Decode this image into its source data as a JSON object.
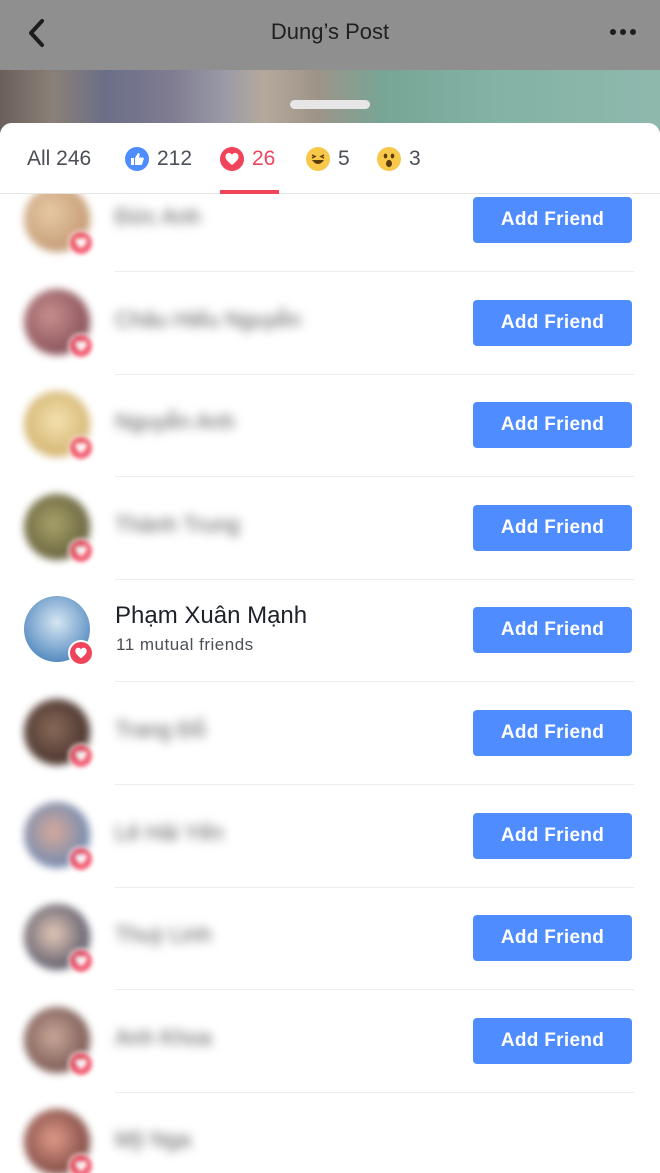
{
  "nav": {
    "title": "Dung’s Post"
  },
  "tabs": [
    {
      "id": "all",
      "label": "All 246",
      "count": "246"
    },
    {
      "id": "like",
      "label": "212",
      "icon": "like-icon",
      "color": "#4e8cff"
    },
    {
      "id": "love",
      "label": "26",
      "icon": "love-icon",
      "color": "#f0445c",
      "selected": true
    },
    {
      "id": "haha",
      "label": "5",
      "icon": "haha-icon"
    },
    {
      "id": "wow",
      "label": "3",
      "icon": "wow-icon"
    }
  ],
  "button_label": "Add Friend",
  "people": [
    {
      "name": "Đức Anh",
      "blurred": true,
      "mutual": ""
    },
    {
      "name": "Châu Hiếu Nguyễn",
      "blurred": true,
      "mutual": ""
    },
    {
      "name": "Nguyễn Anh",
      "blurred": true,
      "mutual": ""
    },
    {
      "name": "Thành Trung",
      "blurred": true,
      "mutual": ""
    },
    {
      "name": "Phạm Xuân Mạnh",
      "blurred": false,
      "mutual": "11 mutual friends"
    },
    {
      "name": "Trang Đỗ",
      "blurred": true,
      "mutual": ""
    },
    {
      "name": "Lê Hải Yến",
      "blurred": true,
      "mutual": ""
    },
    {
      "name": "Thuỳ Linh",
      "blurred": true,
      "mutual": ""
    },
    {
      "name": "Anh Khoa",
      "blurred": true,
      "mutual": ""
    },
    {
      "name": "Mỹ Nga",
      "blurred": true,
      "mutual": ""
    }
  ],
  "colors": {
    "accent": "#4e8cff",
    "love": "#f0445c"
  }
}
